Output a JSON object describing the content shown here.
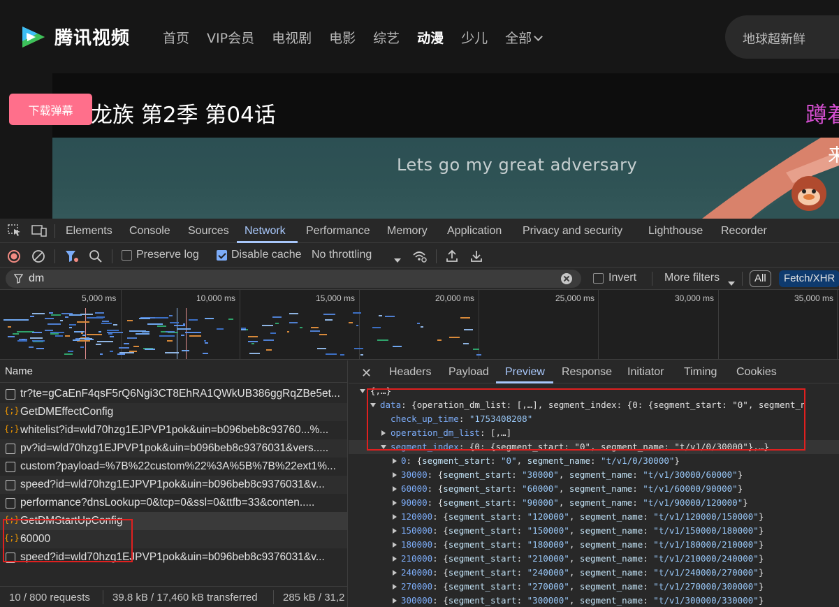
{
  "site": {
    "logo_text": "腾讯视频",
    "nav": [
      "首页",
      "VIP会员",
      "电视剧",
      "电影",
      "综艺",
      "动漫",
      "少儿",
      "全部"
    ],
    "active_nav": 5,
    "search_placeholder": "地球超新鲜",
    "episode_title": "龙族 第2季 第04话",
    "download_danmaku": "下载弹幕",
    "pink_text": "蹲着",
    "subtitle": "Lets go my great adversary",
    "side_char": "来",
    "colors": {
      "download_btn": "#ff6f8b",
      "accent": "#a8c7fa"
    }
  },
  "devtools": {
    "tabs": [
      "Elements",
      "Console",
      "Sources",
      "Network",
      "Performance",
      "Memory",
      "Application",
      "Privacy and security",
      "Lighthouse",
      "Recorder"
    ],
    "active_tab": "Network",
    "toolbar": {
      "preserve_log": "Preserve log",
      "disable_cache": "Disable cache",
      "throttling": "No throttling"
    },
    "filter": {
      "value": "dm",
      "invert": "Invert",
      "more_filters": "More filters",
      "all": "All",
      "fetch_xhr": "Fetch/XHR"
    },
    "timeline_ticks": [
      "5,000 ms",
      "10,000 ms",
      "15,000 ms",
      "20,000 ms",
      "25,000 ms",
      "30,000 ms",
      "35,000 ms"
    ],
    "name_header": "Name",
    "requests": [
      {
        "type": "doc",
        "name": "tr?te=gCaEnF4qsF5rQ6Ngi3CT8EhRA1QWkUB386ggRqZBe5et..."
      },
      {
        "type": "xhr",
        "name": "GetDMEffectConfig"
      },
      {
        "type": "xhr",
        "name": "whitelist?id=wld70hzg1EJPVP1pok&uin=b096beb8c93760...%..."
      },
      {
        "type": "doc",
        "name": "pv?id=wld70hzg1EJPVP1pok&uin=b096beb8c9376031&vers....."
      },
      {
        "type": "doc",
        "name": "custom?payload=%7B%22custom%22%3A%5B%7B%22ext1%..."
      },
      {
        "type": "doc",
        "name": "speed?id=wld70hzg1EJPVP1pok&uin=b096beb8c9376031&v..."
      },
      {
        "type": "doc",
        "name": "performance?dnsLookup=0&tcp=0&ssl=0&ttfb=33&conten....."
      },
      {
        "type": "xhr",
        "name": "GetDMStartUpConfig"
      },
      {
        "type": "xhr",
        "name": "60000"
      },
      {
        "type": "doc",
        "name": "speed?id=wld70hzg1EJPVP1pok&uin=b096beb8c9376031&v..."
      }
    ],
    "status": {
      "requests": "10 / 800 requests",
      "transferred": "39.8 kB / 17,460 kB transferred",
      "resources": "285 kB / 31,2"
    },
    "detail_tabs": [
      "Headers",
      "Payload",
      "Preview",
      "Response",
      "Initiator",
      "Timing",
      "Cookies"
    ],
    "active_detail_tab": "Preview",
    "preview": {
      "root": "{,…}",
      "data_key": "data",
      "data_summary": "{operation_dm_list: [,…], segment_index: {0: {segment_start: \"0\", segment_n",
      "check_up_time_key": "check_up_time",
      "check_up_time_val": "\"1753408208\"",
      "operation_dm_list_key": "operation_dm_list",
      "operation_dm_list_val": "[,…]",
      "segment_index_key": "segment_index",
      "segment_index_summary": "{0: {segment_start: \"0\", segment_name: \"t/v1/0/30000\"},…}",
      "segments": [
        {
          "k": "0",
          "start": "\"0\"",
          "name": "\"t/v1/0/30000\""
        },
        {
          "k": "30000",
          "start": "\"30000\"",
          "name": "\"t/v1/30000/60000\""
        },
        {
          "k": "60000",
          "start": "\"60000\"",
          "name": "\"t/v1/60000/90000\""
        },
        {
          "k": "90000",
          "start": "\"90000\"",
          "name": "\"t/v1/90000/120000\""
        },
        {
          "k": "120000",
          "start": "\"120000\"",
          "name": "\"t/v1/120000/150000\""
        },
        {
          "k": "150000",
          "start": "\"150000\"",
          "name": "\"t/v1/150000/180000\""
        },
        {
          "k": "180000",
          "start": "\"180000\"",
          "name": "\"t/v1/180000/210000\""
        },
        {
          "k": "210000",
          "start": "\"210000\"",
          "name": "\"t/v1/210000/240000\""
        },
        {
          "k": "240000",
          "start": "\"240000\"",
          "name": "\"t/v1/240000/270000\""
        },
        {
          "k": "270000",
          "start": "\"270000\"",
          "name": "\"t/v1/270000/300000\""
        },
        {
          "k": "300000",
          "start": "\"300000\"",
          "name": "\"t/v1/300000/330000\""
        }
      ]
    }
  }
}
